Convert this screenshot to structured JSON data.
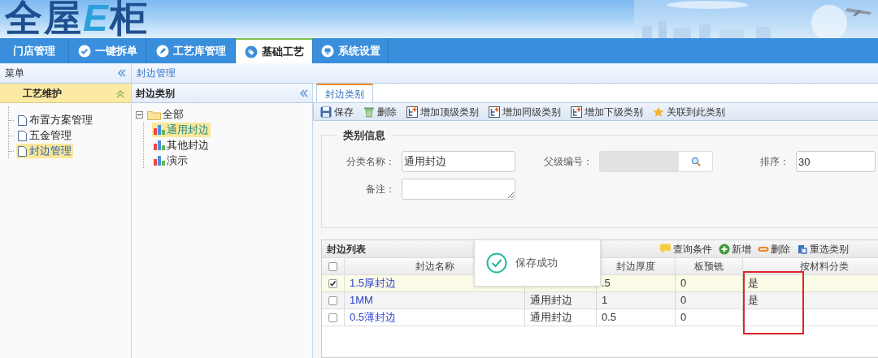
{
  "header": {
    "logo": [
      {
        "text": "全屋",
        "kind": "dark"
      },
      {
        "text": "E",
        "kind": "accent"
      },
      {
        "text": "柜",
        "kind": "dark"
      }
    ]
  },
  "nav_tabs": [
    {
      "label": "门店管理",
      "selected": false
    },
    {
      "label": "一键拆单",
      "selected": false
    },
    {
      "label": "工艺库管理",
      "selected": false
    },
    {
      "label": "基础工艺",
      "selected": true
    },
    {
      "label": "系统设置",
      "selected": false
    }
  ],
  "sidebar": {
    "title": "菜单",
    "section": {
      "title": "工艺维护",
      "expanded": true
    },
    "items": [
      {
        "label": "布置方案管理",
        "selected": false
      },
      {
        "label": "五金管理",
        "selected": false
      },
      {
        "label": "封边管理",
        "selected": true
      }
    ]
  },
  "breadcrumb": "封边管理",
  "category_panel": {
    "title": "封边类别",
    "tree": [
      {
        "label": "全部",
        "expanded": true,
        "selected": false,
        "children": [
          {
            "label": "通用封边",
            "selected": true
          },
          {
            "label": "其他封边",
            "selected": false
          },
          {
            "label": "演示",
            "selected": false
          }
        ]
      }
    ]
  },
  "content_tabs": [
    {
      "label": "封边类别",
      "selected": true
    }
  ],
  "toolbar": [
    "保存",
    "删除",
    "增加顶级类别",
    "增加同级类别",
    "增加下级类别",
    "关联到此类别"
  ],
  "form": {
    "legend": "类别信息",
    "rows": [
      [
        {
          "label": "分类名称：",
          "kind": "text",
          "value": "通用封边"
        },
        {
          "label": "父级编号：",
          "kind": "lookup"
        },
        {
          "label": "排序：",
          "kind": "text",
          "value": "30"
        }
      ],
      [
        {
          "label": "备注：",
          "kind": "textarea"
        }
      ]
    ]
  },
  "list": {
    "title": "封边列表",
    "actions": [
      "查询条件",
      "新增",
      "删除",
      "重选类别"
    ],
    "all_checked": false,
    "highlight": {
      "kind": "frame"
    },
    "columns": [
      "封边名称",
      null,
      "封边厚度",
      "板预铣",
      "按材料分类"
    ],
    "rows": [
      {
        "checked": true,
        "selected": true,
        "cells": [
          "1.5厚封边",
          null,
          ".5",
          "0",
          "是"
        ]
      },
      {
        "checked": false,
        "selected": false,
        "cells": [
          "1MM",
          "通用封边",
          "1",
          "0",
          "是"
        ]
      },
      {
        "checked": false,
        "selected": false,
        "cells": [
          "0.5薄封边",
          "通用封边",
          "0.5",
          "0",
          null
        ]
      }
    ]
  },
  "toast": {
    "text": "保存成功"
  }
}
